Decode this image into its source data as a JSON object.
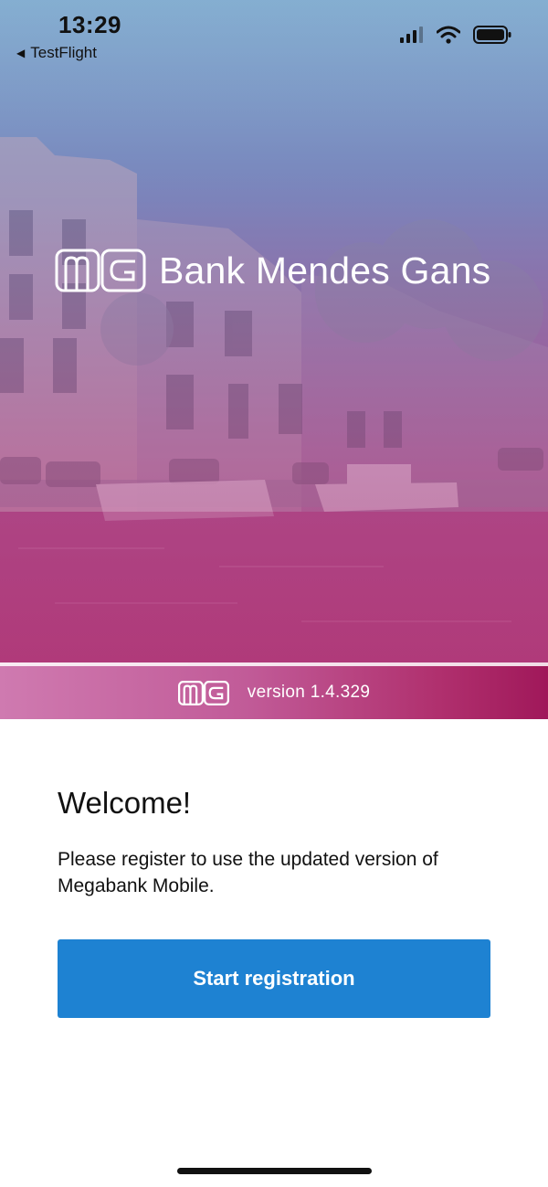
{
  "status_bar": {
    "time": "13:29",
    "back_app": "TestFlight",
    "icons": [
      "cellular-signal-icon",
      "wifi-icon",
      "battery-icon"
    ]
  },
  "brand": {
    "name": "Bank Mendes Gans",
    "logo_icon": "mg-logo-icon"
  },
  "version_bar": {
    "text": "version 1.4.329"
  },
  "welcome": {
    "title": "Welcome!",
    "message": "Please register to use the updated version of Megabank Mobile.",
    "button_label": "Start registration"
  },
  "colors": {
    "primary_button": "#1e82d2",
    "version_strip_start": "#cf7ab0",
    "version_strip_end": "#a0185a"
  }
}
